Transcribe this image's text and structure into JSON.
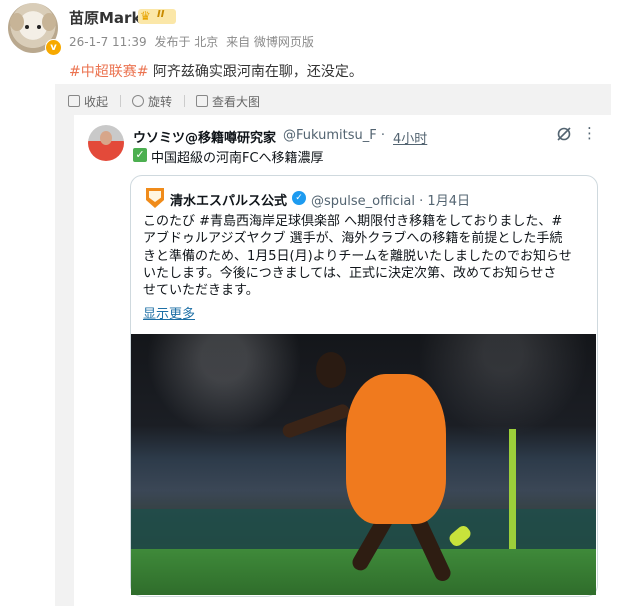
{
  "author": {
    "name": "苗原Mark",
    "level_badge": "II",
    "verified_mark": "v"
  },
  "meta": {
    "time": "26-1-7 11:39",
    "location": "发布于 北京",
    "source": "来自 微博网页版"
  },
  "post": {
    "hashtag": "#中超联赛#",
    "text": " 阿齐兹确实跟河南在聊，还没定。"
  },
  "toolbar": {
    "collect": "收起",
    "rotate": "旋转",
    "view_large": "查看大图"
  },
  "tweet": {
    "name": "ウソミツ@移籍噂研究家",
    "handle": "@Fukumitsu_F",
    "dot": "·",
    "time": "4小时",
    "text": "中国超級の河南FCへ移籍濃厚"
  },
  "quote": {
    "name": "清水エスパルス公式",
    "handle": "@spulse_official",
    "date": "· 1月4日",
    "lines": [
      "このたび #青島西海岸足球倶楽部 へ期限付き移籍をしておりました、#",
      "アブドゥルアジズヤクブ 選手が、海外クラブへの移籍を前提とした手続",
      "きと準備のため、1月5日(月)よりチームを離脱いたしましたのでお知らせ",
      "いたします。今後につきましては、正式に決定次第、改めてお知らせさ",
      "せていただきます。"
    ],
    "show_more": "显示更多"
  },
  "colors": {
    "tag": "#eb7350",
    "link": "#1d6fa5",
    "verified": "#1d9bf0"
  },
  "icons": [
    "collapse-icon",
    "rotate-icon",
    "view-large-icon",
    "grok-icon",
    "more-icon",
    "check-icon",
    "verified-icon"
  ]
}
